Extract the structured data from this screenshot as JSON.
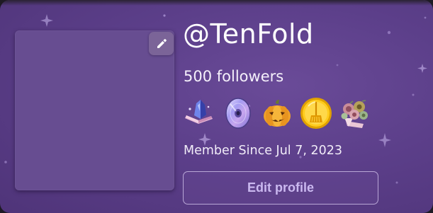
{
  "profile": {
    "username": "@TenFold",
    "followers": "500 followers",
    "member_since": "Member Since Jul 7, 2023",
    "edit_profile_label": "Edit profile"
  },
  "badges": [
    {
      "icon": "crystal-book-badge-icon"
    },
    {
      "icon": "disc-badge-icon"
    },
    {
      "icon": "jack-o-lantern-badge-icon"
    },
    {
      "icon": "gold-coin-broom-badge-icon"
    },
    {
      "icon": "flower-bouquet-badge-icon"
    }
  ],
  "colors": {
    "card_background": "#5c3f8a",
    "avatar_placeholder": "#674d91",
    "edit_button_text": "#cbb9f0",
    "edit_button_border": "#b9a7d6"
  }
}
